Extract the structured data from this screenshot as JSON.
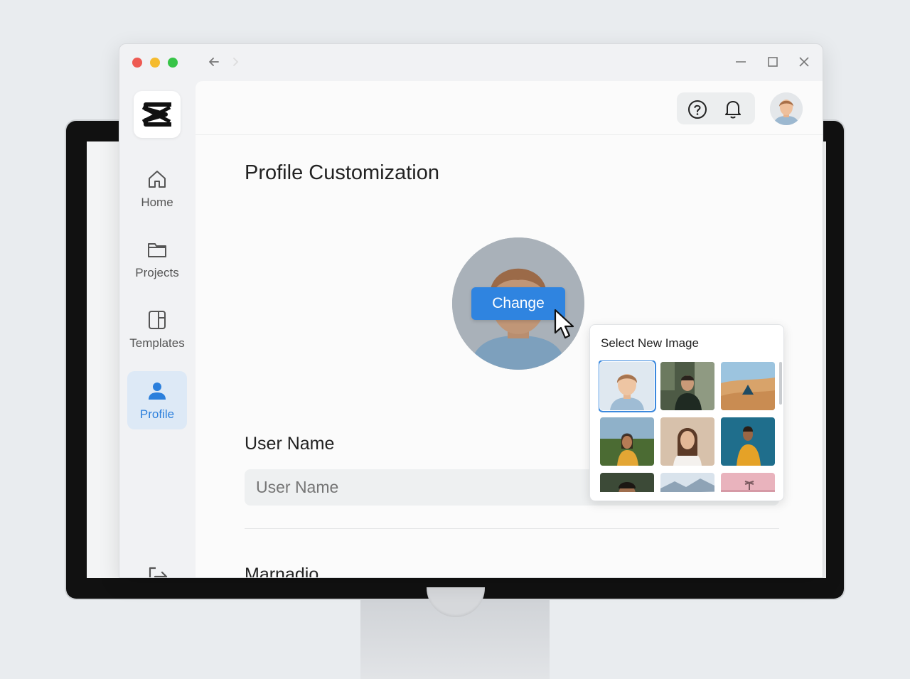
{
  "window": {
    "back_icon": "arrow-left-icon",
    "forward_icon": "chevron-right-icon",
    "controls": [
      "minimize-icon",
      "maximize-icon",
      "close-icon"
    ]
  },
  "sidebar": {
    "logo_icon": "app-logo-icon",
    "items": [
      {
        "label": "Home",
        "icon": "home-icon",
        "active": false
      },
      {
        "label": "Projects",
        "icon": "folder-icon",
        "active": false
      },
      {
        "label": "Templates",
        "icon": "template-icon",
        "active": false
      },
      {
        "label": "Profile",
        "icon": "user-icon",
        "active": true
      }
    ],
    "logout_icon": "logout-icon"
  },
  "header": {
    "help_icon": "help-icon",
    "notifications_icon": "bell-icon",
    "avatar_icon": "avatar"
  },
  "main": {
    "title": "Profile Customization",
    "change_label": "Change",
    "username_label": "User Name",
    "username_placeholder": "User Name",
    "next_section_label": "Marnadio"
  },
  "image_picker": {
    "title": "Select New Image",
    "selected_index": 0,
    "thumbnails": [
      "default-avatar",
      "man-outdoors",
      "desert-tent",
      "woman-field",
      "woman-portrait",
      "woman-yellow-coat",
      "man-portrait",
      "mountain-landscape",
      "pink-sky-palm"
    ]
  },
  "colors": {
    "accent": "#2f84e0",
    "active_nav_bg": "#dde9f6"
  }
}
